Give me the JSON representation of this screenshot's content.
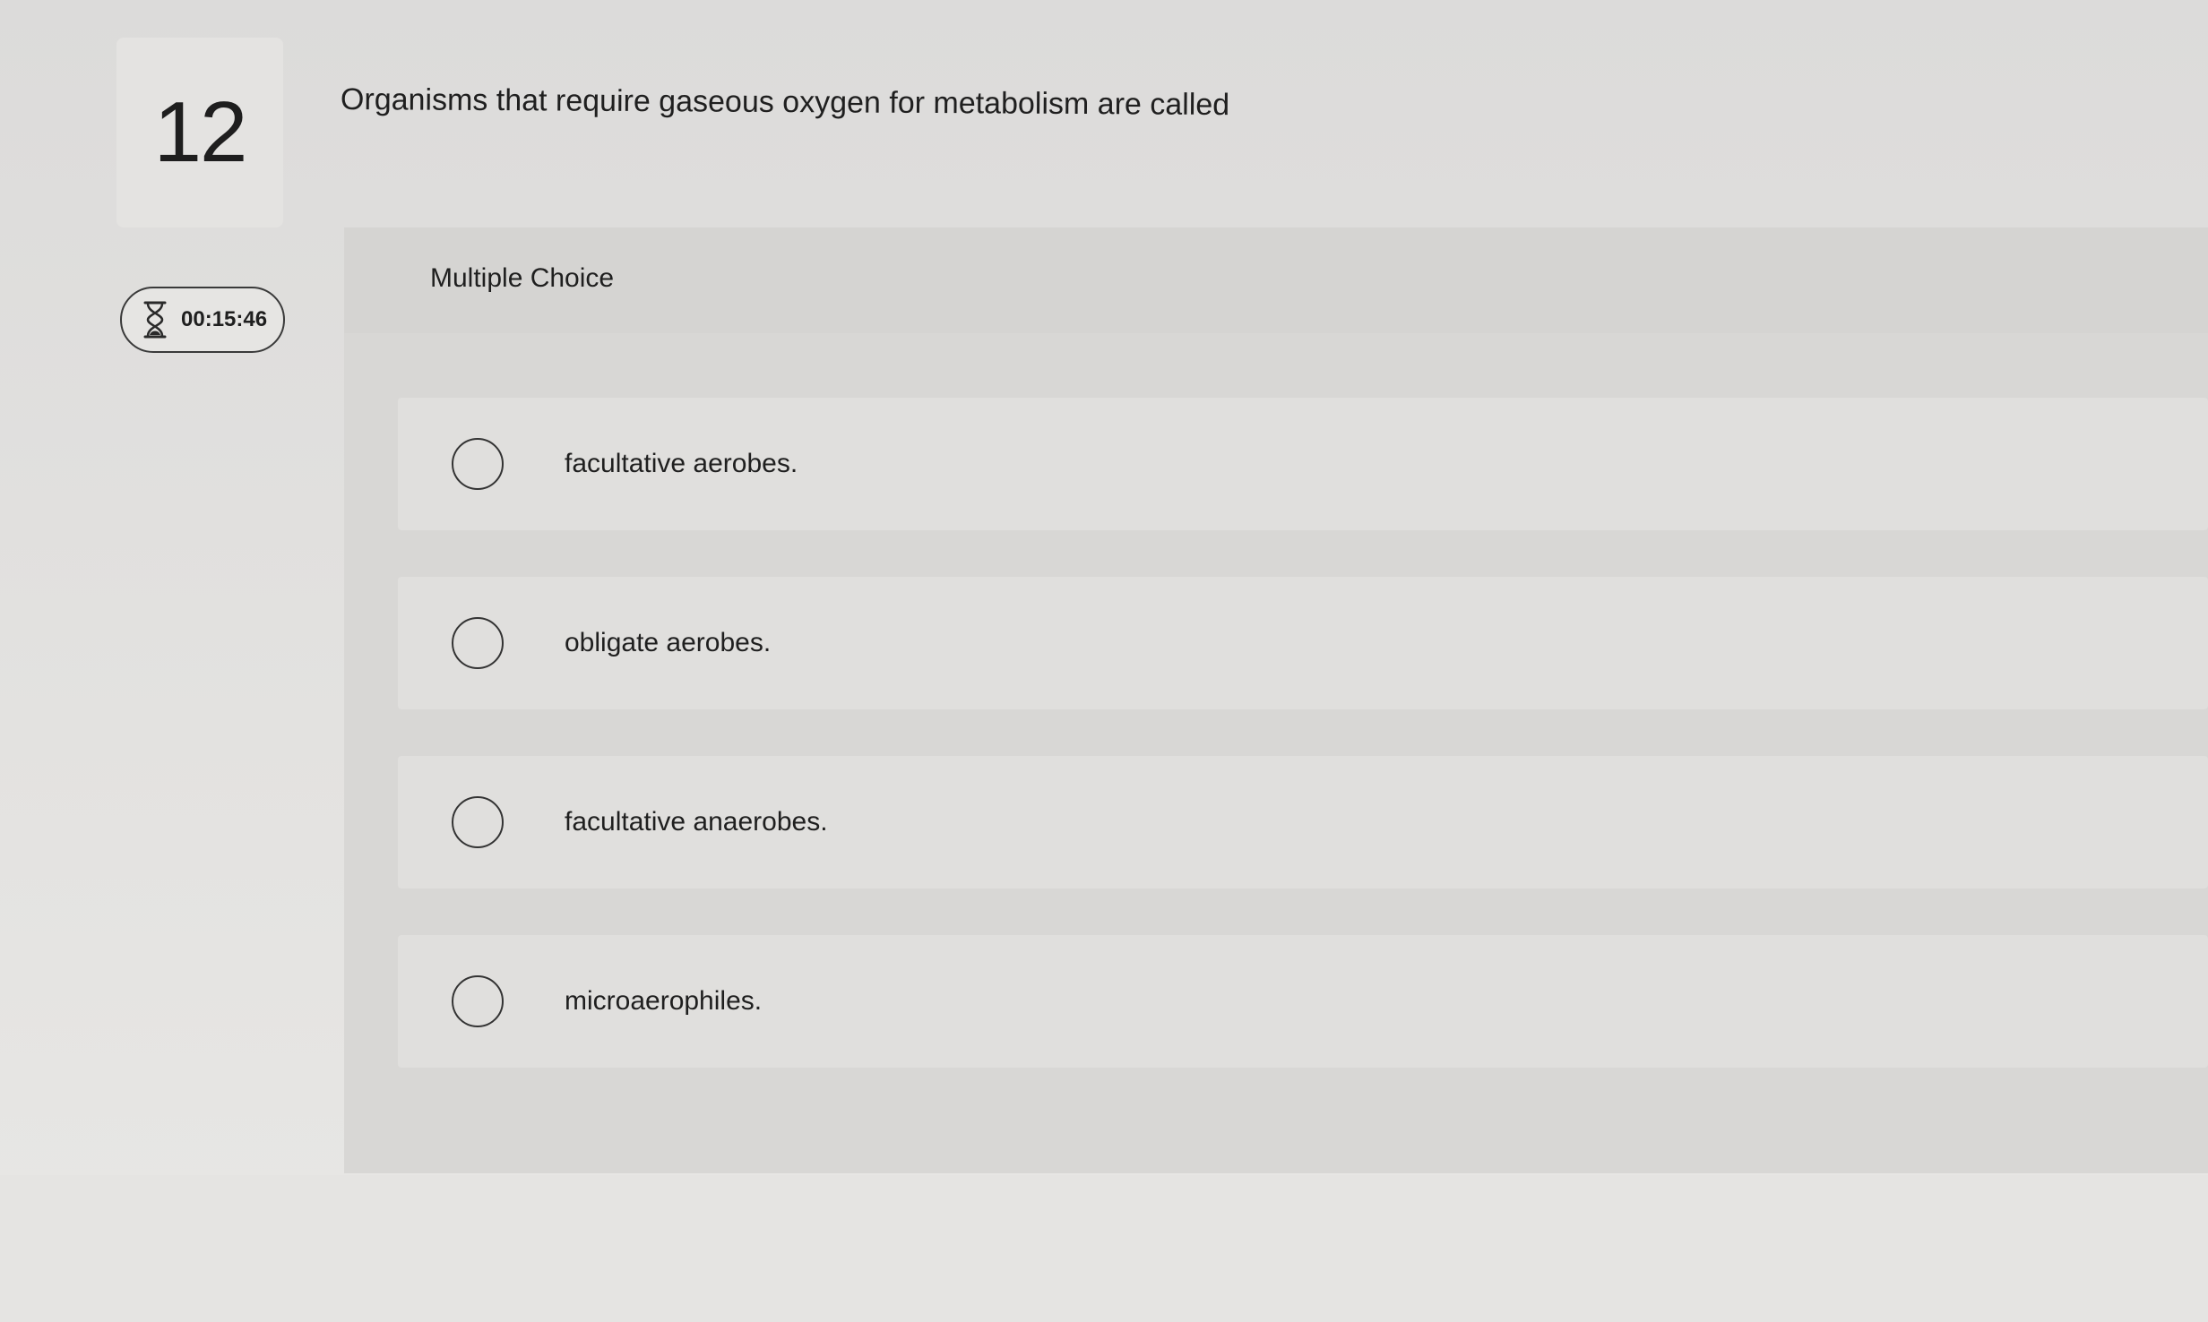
{
  "question": {
    "number": "12",
    "text": "Organisms that require gaseous oxygen for metabolism are called"
  },
  "timer": {
    "icon": "hourglass-icon",
    "value": "00:15:46"
  },
  "answer_panel": {
    "label": "Multiple Choice",
    "options": [
      {
        "label": "facultative aerobes.",
        "selected": false
      },
      {
        "label": "obligate aerobes.",
        "selected": false
      },
      {
        "label": "facultative anaerobes.",
        "selected": false
      },
      {
        "label": "microaerophiles.",
        "selected": false
      }
    ]
  }
}
